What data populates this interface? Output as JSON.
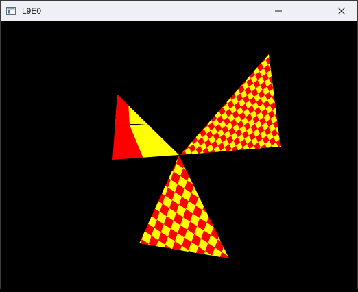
{
  "window": {
    "title": "L9E0",
    "icon": "app-window-icon",
    "controls": {
      "minimize_icon": "minimize-icon",
      "maximize_icon": "maximize-icon",
      "close_icon": "close-icon"
    }
  },
  "scene": {
    "background": "#000000",
    "colors": {
      "check_a": "#ff0000",
      "check_b": "#ffff00"
    },
    "triangles": [
      {
        "name": "left-triangle",
        "checker": "2x2"
      },
      {
        "name": "right-triangle",
        "checker": "fine"
      },
      {
        "name": "bottom-triangle",
        "checker": "medium"
      }
    ]
  }
}
